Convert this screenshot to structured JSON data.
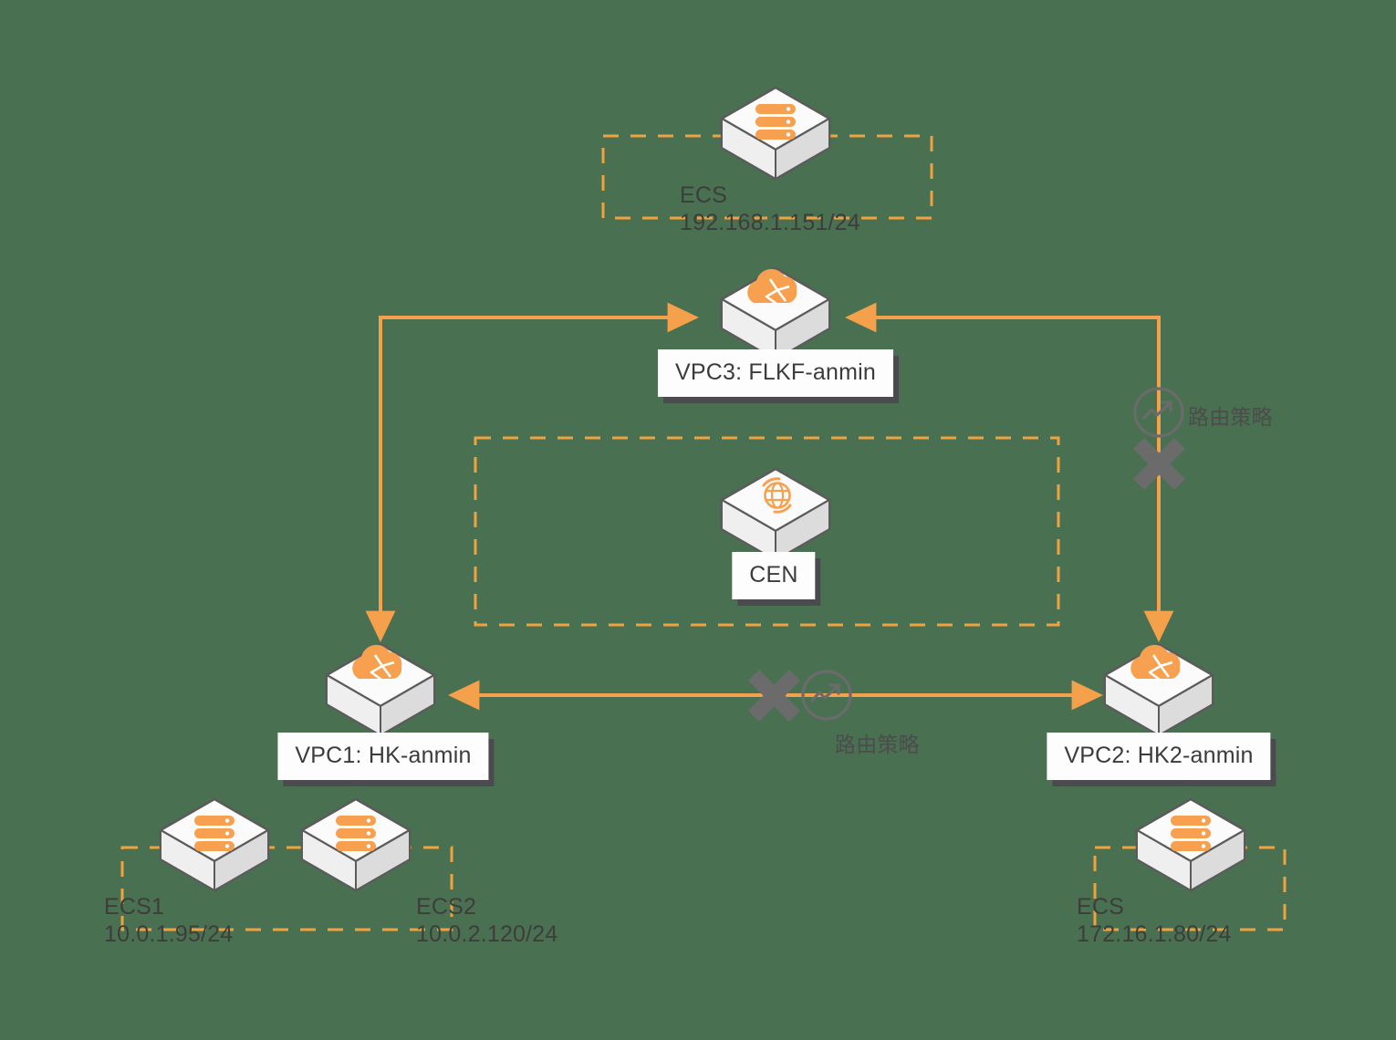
{
  "diagram": {
    "title": "CEN cross-VPC route policy topology",
    "background_color": "#4a7052",
    "accent_color": "#f5a04a",
    "line_color": "#f5a04a",
    "text_color": "#3d3d3b",
    "block_color": "#6b6b6b"
  },
  "nodes": {
    "ecs_top": {
      "icon": "server-icon",
      "name": "ECS",
      "ip": "192.168.1.151/24"
    },
    "vpc3": {
      "icon": "vpc-cloud-icon",
      "label": "VPC3: FLKF-anmin"
    },
    "cen": {
      "icon": "cen-globe-icon",
      "label": "CEN"
    },
    "vpc1": {
      "icon": "vpc-cloud-icon",
      "label": "VPC1: HK-anmin"
    },
    "vpc2": {
      "icon": "vpc-cloud-icon",
      "label": "VPC2: HK2-anmin"
    },
    "ecs1": {
      "icon": "server-icon",
      "name": "ECS1",
      "ip": "10.0.1.95/24"
    },
    "ecs2": {
      "icon": "server-icon",
      "name": "ECS2",
      "ip": "10.0.2.120/24"
    },
    "ecs_right": {
      "icon": "server-icon",
      "name": "ECS",
      "ip": "172.16.1.80/24"
    }
  },
  "annotations": {
    "route_policy_right": "路由策略",
    "route_policy_bottom": "路由策略"
  },
  "connections": [
    {
      "from": "vpc1",
      "to": "vpc3",
      "style": "solid-arrow",
      "direction": "bidirectional-elbow"
    },
    {
      "from": "vpc2",
      "to": "vpc3",
      "style": "solid-arrow",
      "direction": "bidirectional-elbow",
      "blocked": true
    },
    {
      "from": "vpc2",
      "to": "vpc1",
      "style": "solid-arrow",
      "direction": "bidirectional",
      "blocked": true
    }
  ],
  "groups": [
    {
      "name": "ecs-top-group",
      "members": [
        "ecs_top"
      ]
    },
    {
      "name": "cen-group",
      "members": [
        "cen"
      ]
    },
    {
      "name": "ecs-left-group",
      "members": [
        "ecs1",
        "ecs2"
      ]
    },
    {
      "name": "ecs-right-group",
      "members": [
        "ecs_right"
      ]
    }
  ]
}
